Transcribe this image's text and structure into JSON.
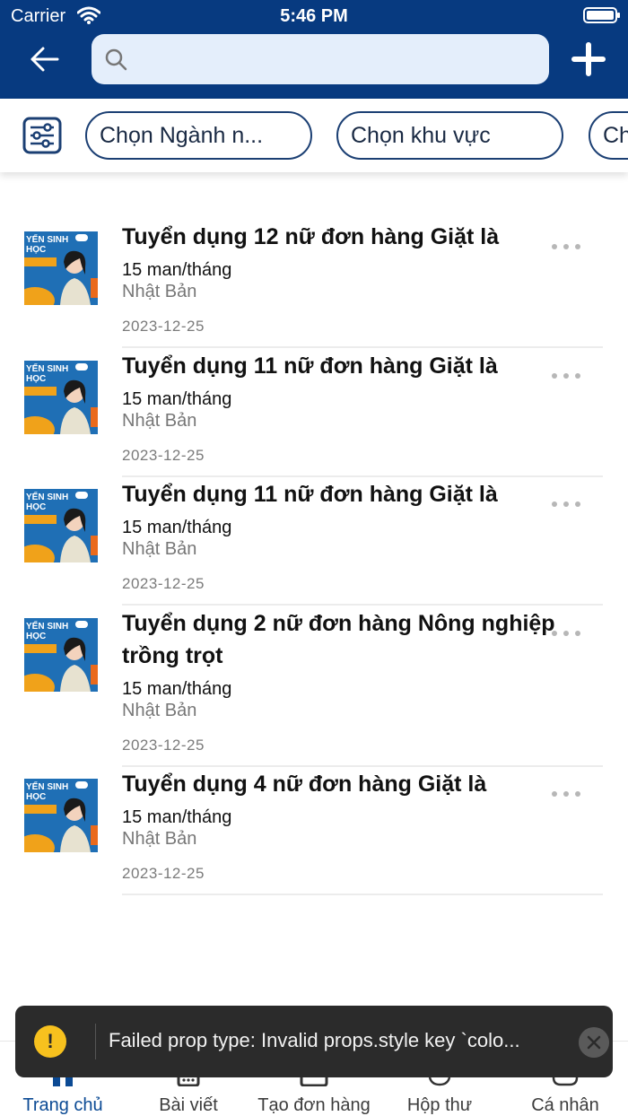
{
  "status_bar": {
    "carrier": "Carrier",
    "time": "5:46 PM",
    "wifi_icon": "wifi-icon",
    "battery_icon": "battery-icon"
  },
  "header": {
    "background": "#073a80",
    "back_icon": "arrow-left-icon",
    "search": {
      "placeholder": "",
      "value": "",
      "icon": "search-icon"
    },
    "add_icon": "plus-icon"
  },
  "filters": {
    "filter_icon": "sliders-icon",
    "chips": [
      {
        "label": "Chọn Ngành n..."
      },
      {
        "label": "Chọn khu vực"
      },
      {
        "label": "Ch"
      }
    ]
  },
  "jobs": [
    {
      "title": "Tuyển dụng 12 nữ đơn hàng Giặt là",
      "salary": "15 man/tháng",
      "location": "Nhật Bản",
      "date": "2023-12-25",
      "thumbnail_text": "YẾN SINH HỌC NHẬT BẢN"
    },
    {
      "title": "Tuyển dụng 11 nữ đơn hàng Giặt là",
      "salary": "15 man/tháng",
      "location": "Nhật Bản",
      "date": "2023-12-25",
      "thumbnail_text": "YẾN SINH HỌC NHẬT BẢN"
    },
    {
      "title": "Tuyển dụng 11 nữ đơn hàng Giặt là",
      "salary": "15 man/tháng",
      "location": "Nhật Bản",
      "date": "2023-12-25",
      "thumbnail_text": "YẾN SINH HỌC NHẬT BẢN"
    },
    {
      "title": "Tuyển dụng 2 nữ đơn hàng Nông nghiệp trồng trọt",
      "salary": "15 man/tháng",
      "location": "Nhật Bản",
      "date": "2023-12-25",
      "thumbnail_text": "YẾN SINH HỌC NHẬT BẢN"
    },
    {
      "title": "Tuyển dụng 4 nữ đơn hàng Giặt là",
      "salary": "15 man/tháng",
      "location": "Nhật Bản",
      "date": "2023-12-25",
      "thumbnail_text": "YẾN SINH HỌC NHẬT BẢN"
    }
  ],
  "toast": {
    "type": "warning",
    "icon": "exclamation-icon",
    "text": "Failed prop type: Invalid props.style key `colo...",
    "close_icon": "close-icon"
  },
  "tabbar": {
    "active_color": "#0b4a94",
    "tabs": [
      {
        "label": "Trang chủ",
        "icon": "home-icon",
        "active": true
      },
      {
        "label": "Bài viết",
        "icon": "article-icon",
        "active": false
      },
      {
        "label": "Tạo đơn hàng",
        "icon": "create-order-icon",
        "active": false
      },
      {
        "label": "Hộp thư",
        "icon": "chat-icon",
        "active": false
      },
      {
        "label": "Cá nhân",
        "icon": "user-icon",
        "active": false
      }
    ]
  }
}
